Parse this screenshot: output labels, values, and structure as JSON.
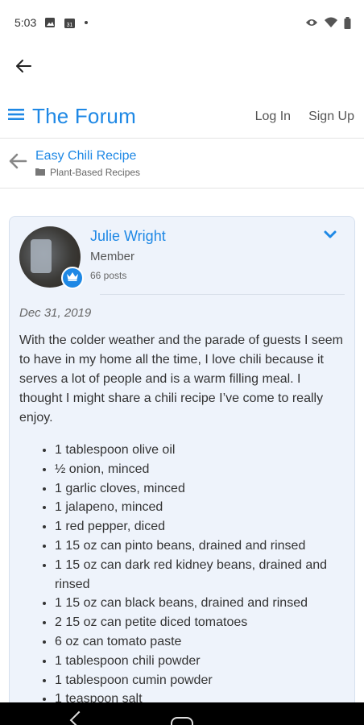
{
  "status_bar": {
    "time": "5:03",
    "calendar_day": "31",
    "icons": [
      "image-icon",
      "calendar-icon",
      "dot-icon",
      "eye-icon",
      "wifi-icon",
      "battery-icon"
    ]
  },
  "forum": {
    "title": "The Forum",
    "login_label": "Log In",
    "signup_label": "Sign Up"
  },
  "topic": {
    "title": "Easy Chili Recipe",
    "category": "Plant-Based Recipes"
  },
  "post": {
    "author_name": "Julie Wright",
    "author_role": "Member",
    "author_posts": "66 posts",
    "date": "Dec 31, 2019",
    "body": "With the colder weather and the parade of guests I seem to have in my home all the time, I love chili because it serves a lot of people and is a warm filling meal. I thought I might share a chili recipe I’ve come to really enjoy.",
    "ingredients": [
      "1 tablespoon olive oil",
      "½ onion, minced",
      "1 garlic cloves, minced",
      "1 jalapeno, minced",
      "1 red pepper, diced",
      "1 15 oz can pinto beans, drained and rinsed",
      "1 15 oz can dark red kidney beans, drained and rinsed",
      "1 15 oz can black beans, drained and rinsed",
      "2 15 oz can petite diced tomatoes",
      "6 oz can tomato paste",
      "1 tablespoon chili powder",
      "1 tablespoon cumin powder",
      "1 teaspoon salt"
    ]
  },
  "colors": {
    "accent": "#1e88e5",
    "card_background": "#eef3fb",
    "text": "#333333"
  }
}
